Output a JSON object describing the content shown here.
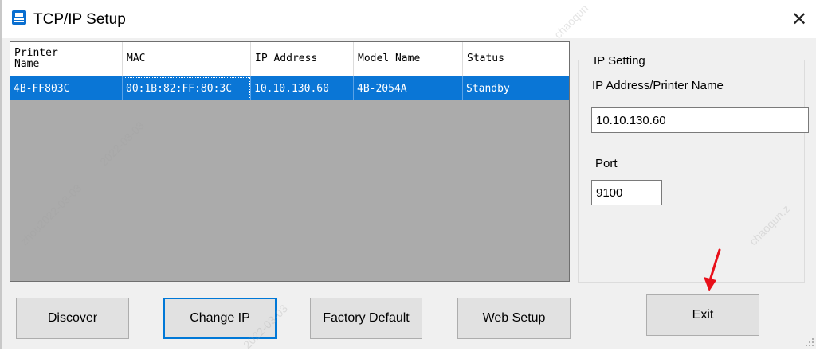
{
  "window": {
    "title": "TCP/IP Setup",
    "close_glyph": "✕"
  },
  "list": {
    "headers": [
      "Printer\nName",
      "MAC",
      "IP Address",
      "Model Name",
      "Status"
    ],
    "rows": [
      {
        "printer_name": "4B-FF803C",
        "mac": "00:1B:82:FF:80:3C",
        "ip": "10.10.130.60",
        "model": "4B-2054A",
        "status": "Standby"
      }
    ]
  },
  "buttons": {
    "discover": "Discover",
    "change_ip": "Change IP",
    "factory_default": "Factory Default",
    "web_setup": "Web Setup",
    "exit": "Exit"
  },
  "ip_setting": {
    "legend": "IP Setting",
    "ip_label": "IP Address/Printer Name",
    "ip_value": "10.10.130.60",
    "port_label": "Port",
    "port_value": "9100"
  },
  "watermarks": [
    "chaoqun",
    "zhou2022-03-03",
    "2022-03-03",
    "chaoqun.z",
    "2022-03-03"
  ],
  "colors": {
    "selection": "#0a76d6",
    "list_background": "#ababab",
    "arrow": "#e8101a",
    "focus_border": "#0078d7"
  },
  "icons": [
    "printer-icon",
    "close-icon",
    "red-arrow-icon",
    "resize-grip-icon"
  ]
}
